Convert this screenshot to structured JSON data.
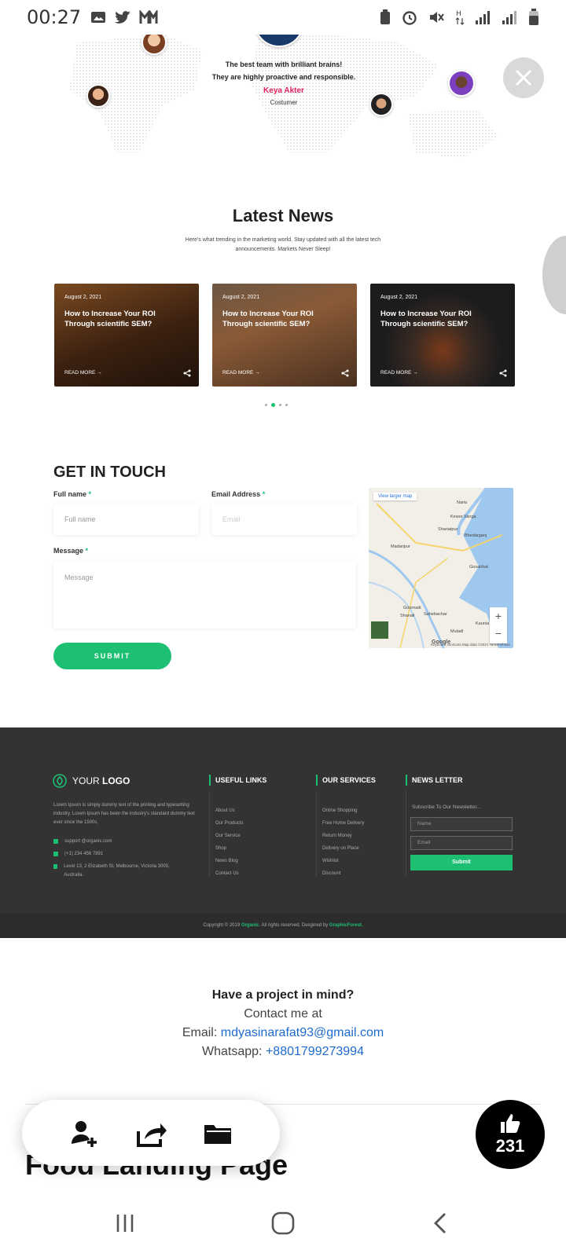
{
  "status_bar": {
    "time": "00:27"
  },
  "testimonial": {
    "quote_line1": "The best team with brilliant brains!",
    "quote_line2": "They are highly proactive and responsible.",
    "name": "Keya Akter",
    "role": "Costumer"
  },
  "news": {
    "title": "Latest News",
    "subtitle": "Here's what trending in the marketing world. Stay updated with all the latest tech announcements. Markets Never Sleep!",
    "cards": [
      {
        "date": "August 2, 2021",
        "title": "How to Increase Your ROI Through scientific SEM?",
        "read_more": "READ MORE →"
      },
      {
        "date": "August 2, 2021",
        "title": "How to Increase Your ROI Through scientific SEM?",
        "read_more": "READ MORE →"
      },
      {
        "date": "August 2, 2021",
        "title": "How to Increase Your ROI Through scientific SEM?",
        "read_more": "READ MORE →"
      }
    ]
  },
  "contact": {
    "title": "GET IN TOUCH",
    "full_name_label": "Full name",
    "full_name_placeholder": "Full name",
    "email_label": "Email Address",
    "email_placeholder": "Email",
    "message_label": "Message",
    "message_placeholder": "Message",
    "submit": "SUBMIT",
    "map": {
      "view_larger": "View larger map",
      "google": "Google",
      "attribution": "Keyboard shortcuts  Map data ©2021  Terms of Use",
      "places": [
        "Madaripur",
        "Shariatpur",
        "Bhedarganj",
        "Gosairhat",
        "Gournadi",
        "Sahebachar",
        "Muladi",
        "Kaunia",
        "Naria",
        "Kewor Vanga",
        "Shanail"
      ]
    }
  },
  "footer": {
    "logo_your": "YOUR",
    "logo_logo": "LOGO",
    "description": "Lorem Ipsum is simply dummy text of the printing and typesetting industry. Lorem Ipsum has been the industry's standard dummy text ever since the 1500s,",
    "email": "support @organic.com",
    "phone": "(+1) 234 456 7891",
    "address": "Level 13, 2 Elizabeth St, Melbourne, Victoria 3000, Australia.",
    "useful_links_title": "USEFUL LINKS",
    "useful_links": [
      "About Us",
      "Our Products",
      "Our Service",
      "Shop",
      "News Blog",
      "Contact Us"
    ],
    "services_title": "OUR SERVICES",
    "services": [
      "Online Shopping",
      "Free Home Delivery",
      "Return Money",
      "Delivery on Place",
      "Wishlist",
      "Discount"
    ],
    "newsletter_title": "NEWS LETTER",
    "newsletter_sub": "Subscribe To Our Newsletter...",
    "newsletter_name": "Name",
    "newsletter_email": "Email",
    "newsletter_submit": "Submit",
    "copyright_pre": "Copyright © 2019 ",
    "copyright_brand": "Organic",
    "copyright_mid": ". All rights reserved. Desgined by ",
    "copyright_by": "GraphicForest."
  },
  "project": {
    "heading": "Have a project in mind?",
    "contact_me": "Contact me at",
    "email_label": "Email: ",
    "email": "mdyasinarafat93@gmail.com",
    "whatsapp_label": "Whatsapp: ",
    "whatsapp": "+8801799273994"
  },
  "page_title": "Food Landing Page",
  "likes": "231",
  "colors": {
    "accent": "#1dbf73",
    "footer_bg": "#333334",
    "link": "#1e6bd0"
  }
}
